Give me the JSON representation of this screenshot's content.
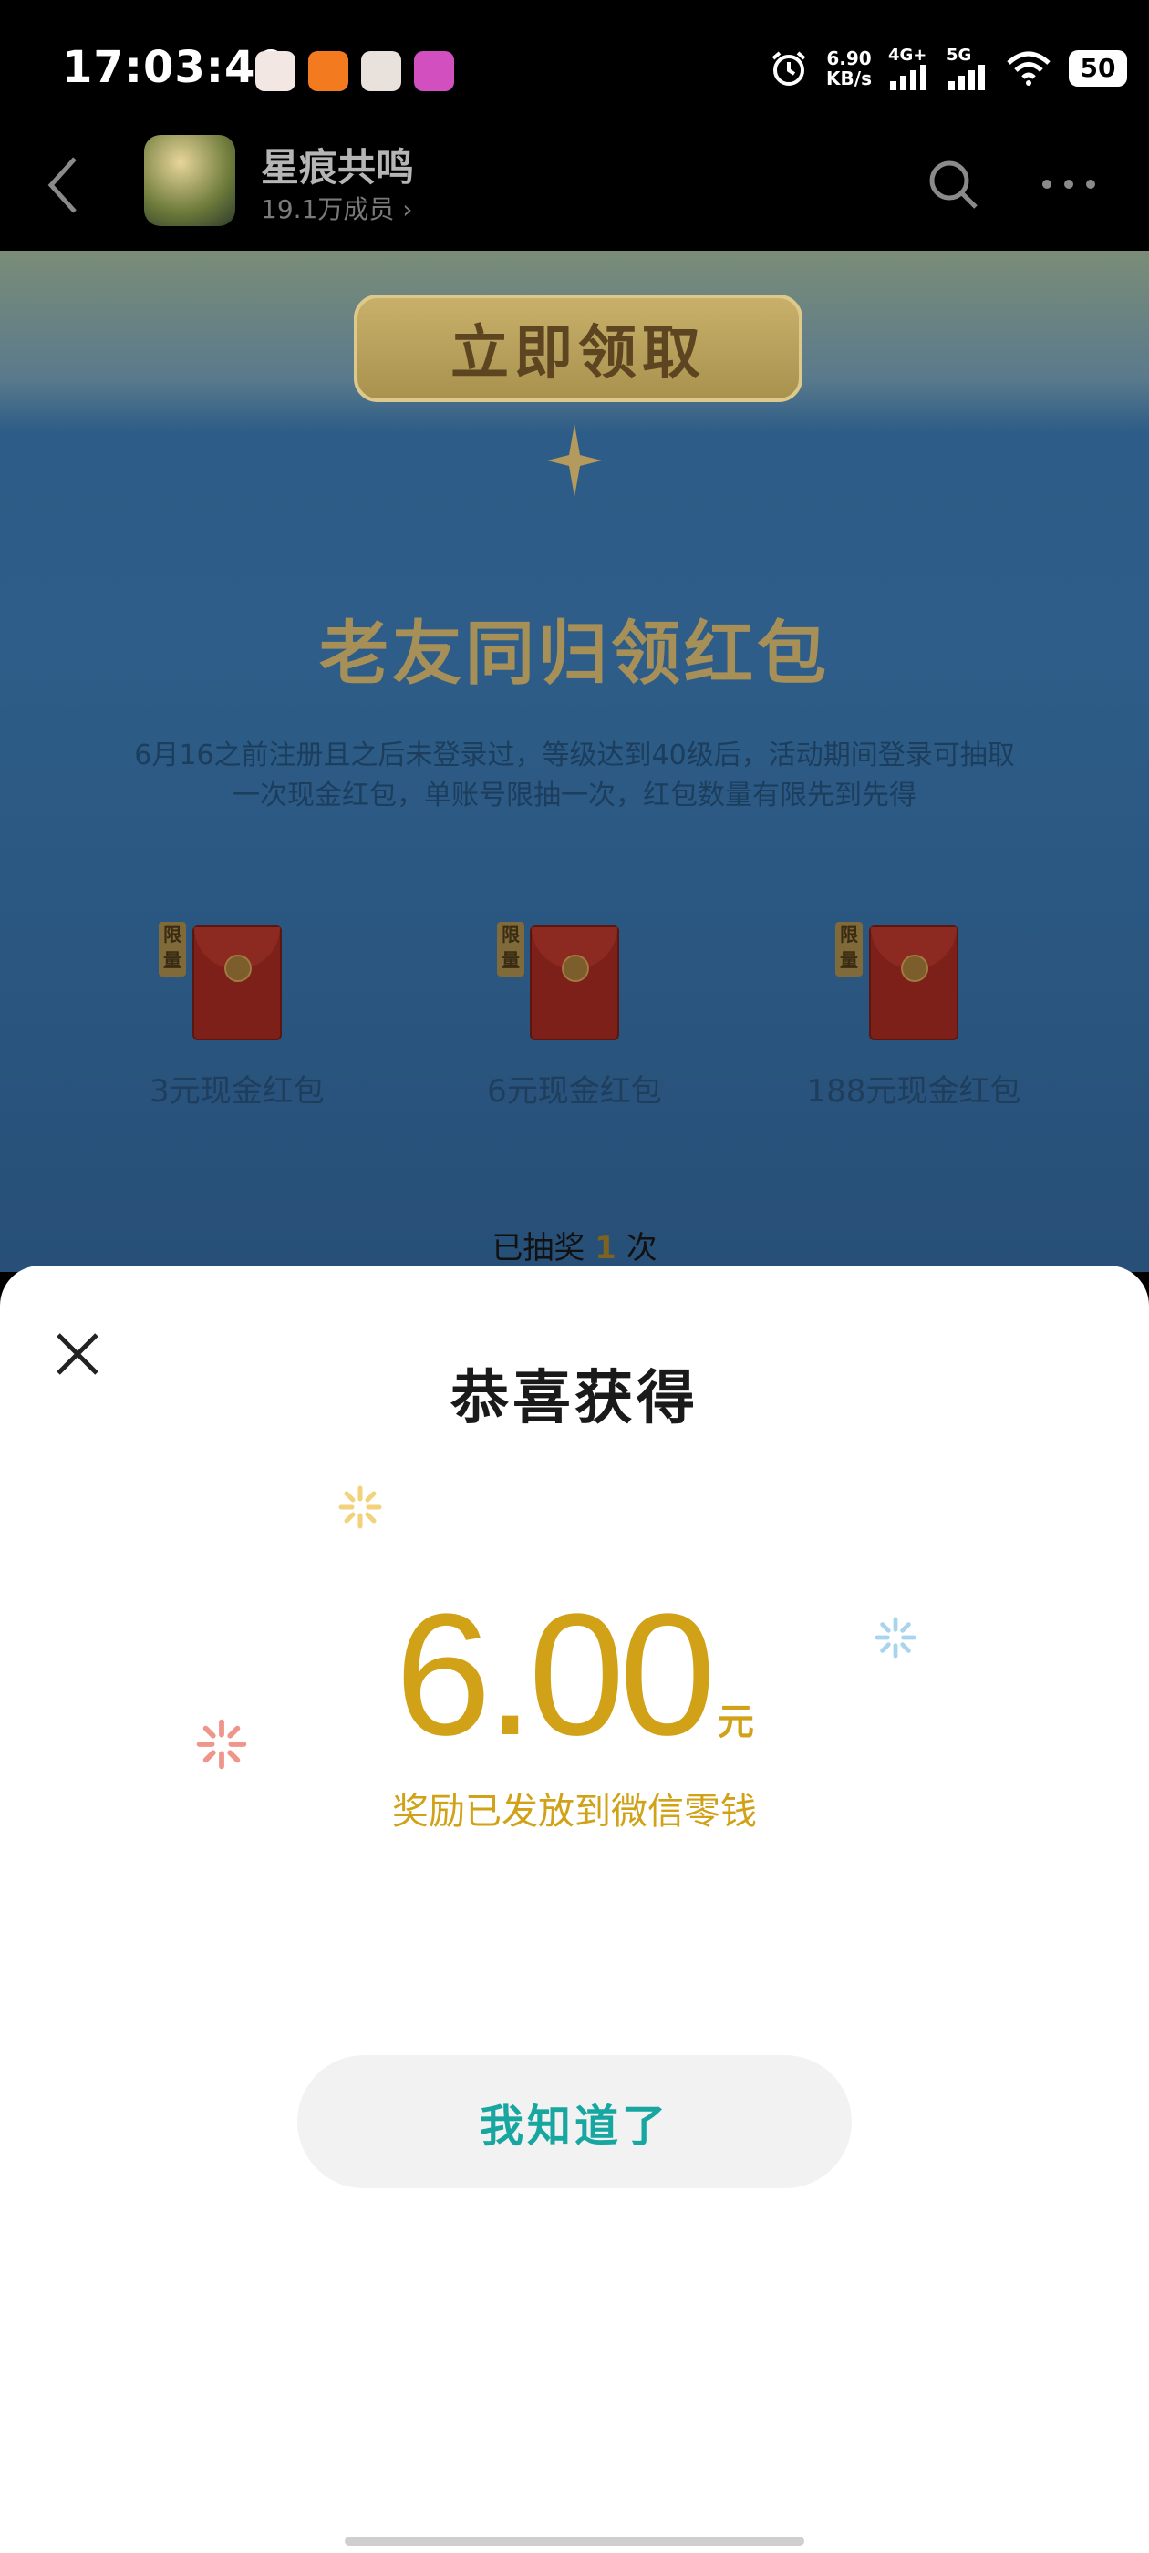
{
  "status_bar": {
    "time": "17:03:40",
    "network_speed_value": "6.90",
    "network_speed_unit": "KB/s",
    "signal_1": "4G+",
    "signal_2": "5G",
    "battery": "50"
  },
  "header": {
    "group_title": "星痕共鸣",
    "members": "19.1万成员",
    "icons": [
      "back-arrow-icon",
      "search-icon",
      "more-icon"
    ]
  },
  "background_page": {
    "claim_button": "立即领取",
    "event_title": "老友同归领红包",
    "description_line1": "6月16之前注册且之后未登录过，等级达到40级后，活动期间登录可抽取",
    "description_line2": "一次现金红包，单账号限抽一次，红包数量有限先到先得",
    "limit_tag": "限量",
    "prizes": [
      {
        "label": "3元现金红包"
      },
      {
        "label": "6元现金红包"
      },
      {
        "label": "188元现金红包"
      }
    ],
    "draw_prefix": "已抽奖",
    "draw_count": "1",
    "draw_suffix": "次"
  },
  "modal": {
    "title": "恭喜获得",
    "amount": "6.00",
    "unit": "元",
    "note": "奖励已发放到微信零钱",
    "confirm_button": "我知道了",
    "colors": {
      "accent_gold": "#d1a117",
      "button_text": "#17a6a0"
    }
  }
}
